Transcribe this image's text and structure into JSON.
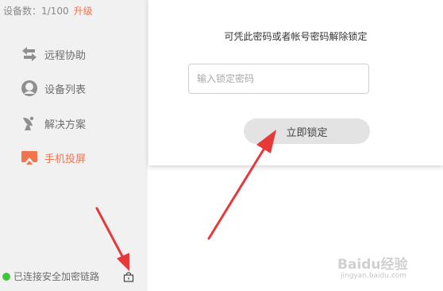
{
  "sidebar": {
    "device_count": "设备数：1/100",
    "upgrade_label": "升级",
    "items": [
      {
        "label": "远程协助",
        "icon": "swap-arrows-icon",
        "active": false
      },
      {
        "label": "设备列表",
        "icon": "device-list-icon",
        "active": false
      },
      {
        "label": "解决方案",
        "icon": "satellite-dish-icon",
        "active": false
      },
      {
        "label": "手机投屏",
        "icon": "screen-cast-icon",
        "active": true
      }
    ],
    "status_text": "已连接安全加密链路",
    "status_color": "#3fc53a",
    "lock_icon": "lock-icon"
  },
  "lock_panel": {
    "hint": "可凭此密码或者帐号密码解除锁定",
    "password_input": {
      "value": "",
      "placeholder": "输入锁定密码"
    },
    "lock_now_label": "立即锁定"
  },
  "annotations": {
    "arrow_color": "#e8393a"
  },
  "watermark": {
    "text": "Baidu经验",
    "sub": "jingyan.baidu.com"
  },
  "colors": {
    "accent": "#f2744f",
    "sidebar_bg": "#f1f1f1",
    "button_bg": "#e3e3e3"
  }
}
